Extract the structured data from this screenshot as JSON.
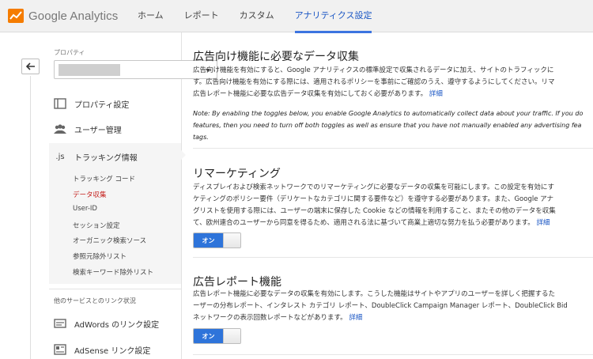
{
  "app": {
    "logo_text": "Google Analytics"
  },
  "nav": {
    "items": [
      {
        "label": "ホーム"
      },
      {
        "label": "レポート"
      },
      {
        "label": "カスタム"
      },
      {
        "label": "アナリティクス設定"
      }
    ],
    "active_index": 3
  },
  "sidebar": {
    "property_label": "プロパティ",
    "items": {
      "property_settings": "プロパティ設定",
      "user_management": "ユーザー管理",
      "tracking_info": "トラッキング情報",
      "tracking_icon": ".js"
    },
    "tracking_sub": [
      {
        "label": "トラッキング コード"
      },
      {
        "label": "データ収集"
      },
      {
        "label": "User-ID"
      },
      {
        "label": "セッション設定"
      },
      {
        "label": "オーガニック検索ソース"
      },
      {
        "label": "参照元除外リスト"
      },
      {
        "label": "検索キーワード除外リスト"
      }
    ],
    "tracking_sub_active_index": 1,
    "linking_section_title": "他のサービスとのリンク状況",
    "linking_items": {
      "adwords": "AdWords のリンク設定",
      "adsense": "AdSense リンク設定"
    }
  },
  "main": {
    "ads_features": {
      "title": "広告向け機能に必要なデータ収集",
      "lines": [
        "広告向け機能を有効にすると、Google アナリティクスの標準設定で収集されるデータに加え、サイトのトラフィックに",
        "す。広告向け機能を有効にする際には、適用されるポリシーを事前にご確認のうえ、遵守するようにしてください。リマ",
        "広告レポート機能に必要な広告データ収集を有効にしておく必要があります。"
      ],
      "link": "詳細",
      "note_lines": [
        "Note: By enabling the toggles below, you enable Google Analytics to automatically collect data about your traffic. If you do",
        "features, then you need to turn off both toggles as well as ensure that you have not manually enabled any advertising fea",
        "tags."
      ]
    },
    "remarketing": {
      "title": "リマーケティング",
      "lines": [
        "ディスプレイおよび検索ネットワークでのリマーケティングに必要なデータの収集を可能にします。この設定を有効にす",
        "ケティングのポリシー要件（デリケートなカテゴリに関する要件など）を遵守する必要があります。また、Google アナ",
        "グリストを使用する際には、ユーザーの端末に保存した Cookie などの情報を利用すること、またその他のデータを収集",
        "て、欧州連合のユーザーから同意を得るため、適用される法に基づいて商業上適切な努力を払う必要があります。"
      ],
      "link": "詳細",
      "toggle_label": "オン"
    },
    "ad_reporting": {
      "title": "広告レポート機能",
      "lines": [
        "広告レポート機能に必要なデータの収集を有効にします。こうした機能はサイトやアプリのユーザーを詳しく把握するた",
        "ーザーの分布レポート、インタレスト カテゴリ レポート、DoubleClick Campaign Manager レポート、DoubleClick Bid",
        "ネットワークの表示回数レポートなどがあります。"
      ],
      "link": "詳細",
      "toggle_label": "オン"
    }
  },
  "colors": {
    "accent": "#3c74e0",
    "toggle_on": "#2e74da",
    "active_sub": "#c5221f",
    "link": "#1a56c4"
  }
}
